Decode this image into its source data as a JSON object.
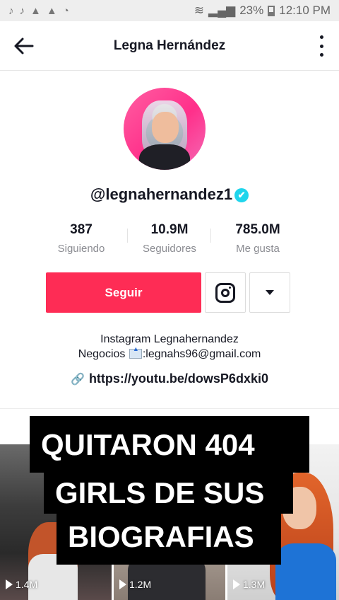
{
  "status_bar": {
    "left_icons": [
      "tiktok-icon",
      "tiktok-icon",
      "warning-icon",
      "warning-icon",
      "sync-icon"
    ],
    "battery": "23%",
    "time": "12:10 PM"
  },
  "header": {
    "title": "Legna Hernández"
  },
  "profile": {
    "username": "@legnahernandez1",
    "verified_mark": "✔",
    "stats": [
      {
        "value": "387",
        "label": "Siguiendo"
      },
      {
        "value": "10.9M",
        "label": "Seguidores"
      },
      {
        "value": "785.0M",
        "label": "Me gusta"
      }
    ],
    "follow_label": "Seguir",
    "bio_line1": "Instagram Legnahernandez",
    "bio_line2_prefix": "Negocios",
    "bio_line2_suffix": ":legnahs96@gmail.com",
    "link": "https://youtu.be/dowsP6dxki0",
    "link_icon": "🔗"
  },
  "videos": [
    {
      "views": "1.4M"
    },
    {
      "views": "1.2M"
    },
    {
      "views": "1.3M"
    }
  ],
  "caption": {
    "line1": "QUITARON 404",
    "line2": "GIRLS DE SUS",
    "line3": "BIOGRAFIAS"
  },
  "colors": {
    "accent": "#fe2c55",
    "verified": "#20d5ec"
  }
}
